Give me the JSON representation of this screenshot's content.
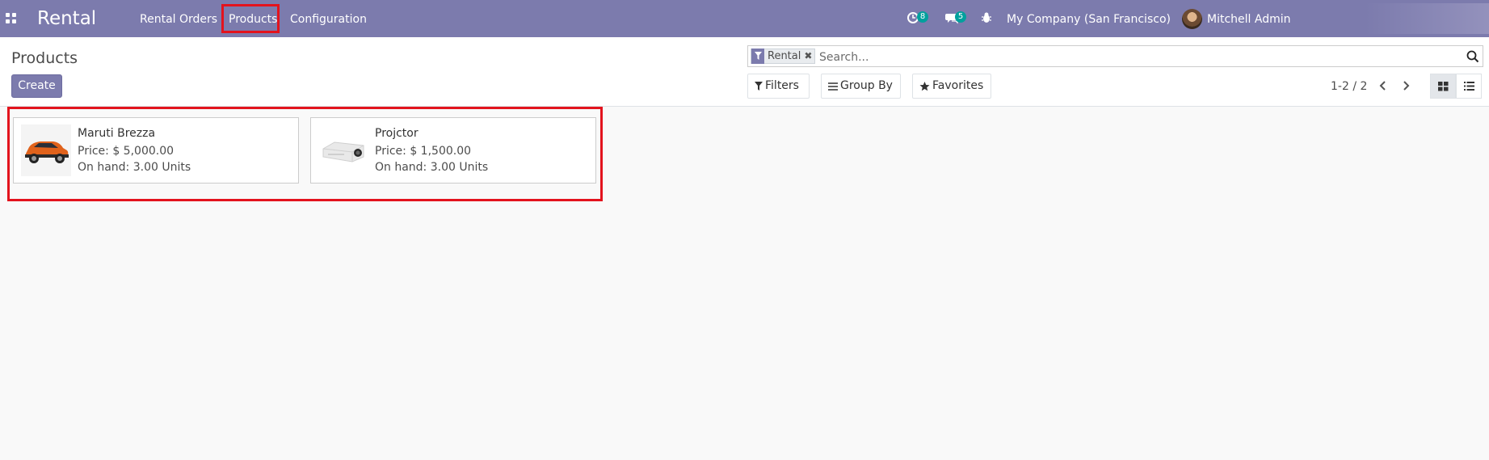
{
  "navbar": {
    "apps_icon": "grid-icon",
    "brand": "Rental",
    "menu": [
      {
        "label": "Rental Orders"
      },
      {
        "label": "Products"
      },
      {
        "label": "Configuration"
      }
    ],
    "activity_badge": "8",
    "messages_badge": "5",
    "company": "My Company (San Francisco)",
    "user": "Mitchell Admin"
  },
  "control_panel": {
    "title": "Products",
    "create_label": "Create",
    "search": {
      "facet_label": "Rental",
      "placeholder": "Search..."
    },
    "filters_label": "Filters",
    "group_by_label": "Group By",
    "favorites_label": "Favorites",
    "pager": "1-2 / 2"
  },
  "products": [
    {
      "name": "Maruti Brezza",
      "price": "Price: $ 5,000.00",
      "on_hand": "On hand: 3.00 Units",
      "image": "car-image"
    },
    {
      "name": "Projctor",
      "price": "Price: $ 1,500.00",
      "on_hand": "On hand: 3.00 Units",
      "image": "projector-image"
    }
  ],
  "colors": {
    "navbar": "#7c7bad",
    "highlight": "#e3131d",
    "badge": "#00a09d"
  }
}
